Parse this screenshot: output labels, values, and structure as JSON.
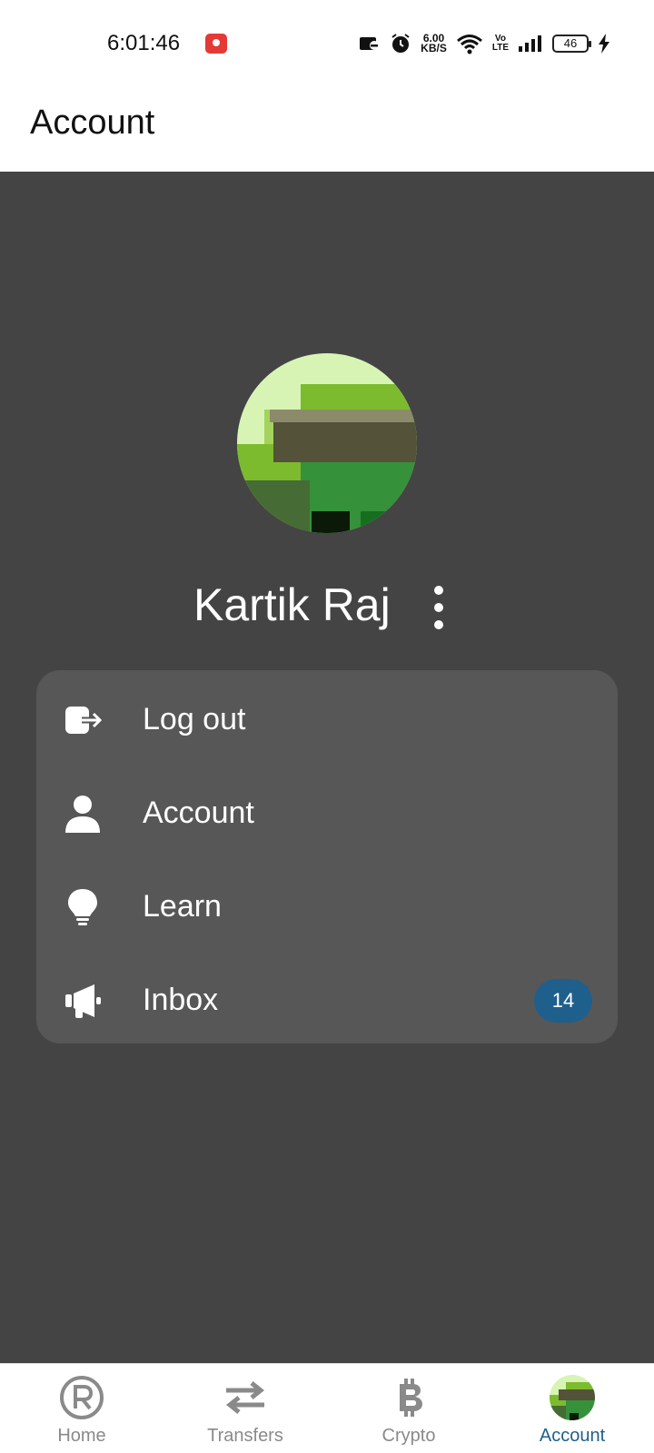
{
  "status_bar": {
    "time": "6:01:46",
    "net_speed_value": "6.00",
    "net_speed_unit": "KB/S",
    "volte_top": "Vo",
    "volte_bottom": "LTE",
    "battery": "46"
  },
  "header": {
    "title": "Account"
  },
  "profile": {
    "name": "Kartik Raj"
  },
  "menu": {
    "items": [
      {
        "label": "Log out",
        "icon": "logout-icon"
      },
      {
        "label": "Account",
        "icon": "person-icon"
      },
      {
        "label": "Learn",
        "icon": "lightbulb-icon"
      },
      {
        "label": "Inbox",
        "icon": "megaphone-icon",
        "badge": "14"
      }
    ]
  },
  "bottom_nav": {
    "items": [
      {
        "label": "Home",
        "icon": "registered-icon"
      },
      {
        "label": "Transfers",
        "icon": "transfer-arrows-icon"
      },
      {
        "label": "Crypto",
        "icon": "bitcoin-icon"
      },
      {
        "label": "Account",
        "icon": "avatar-icon",
        "active": true
      }
    ]
  },
  "colors": {
    "background": "#444444",
    "card": "#575757",
    "accent": "#1f5f8b",
    "inactive": "#8a8a8a"
  }
}
